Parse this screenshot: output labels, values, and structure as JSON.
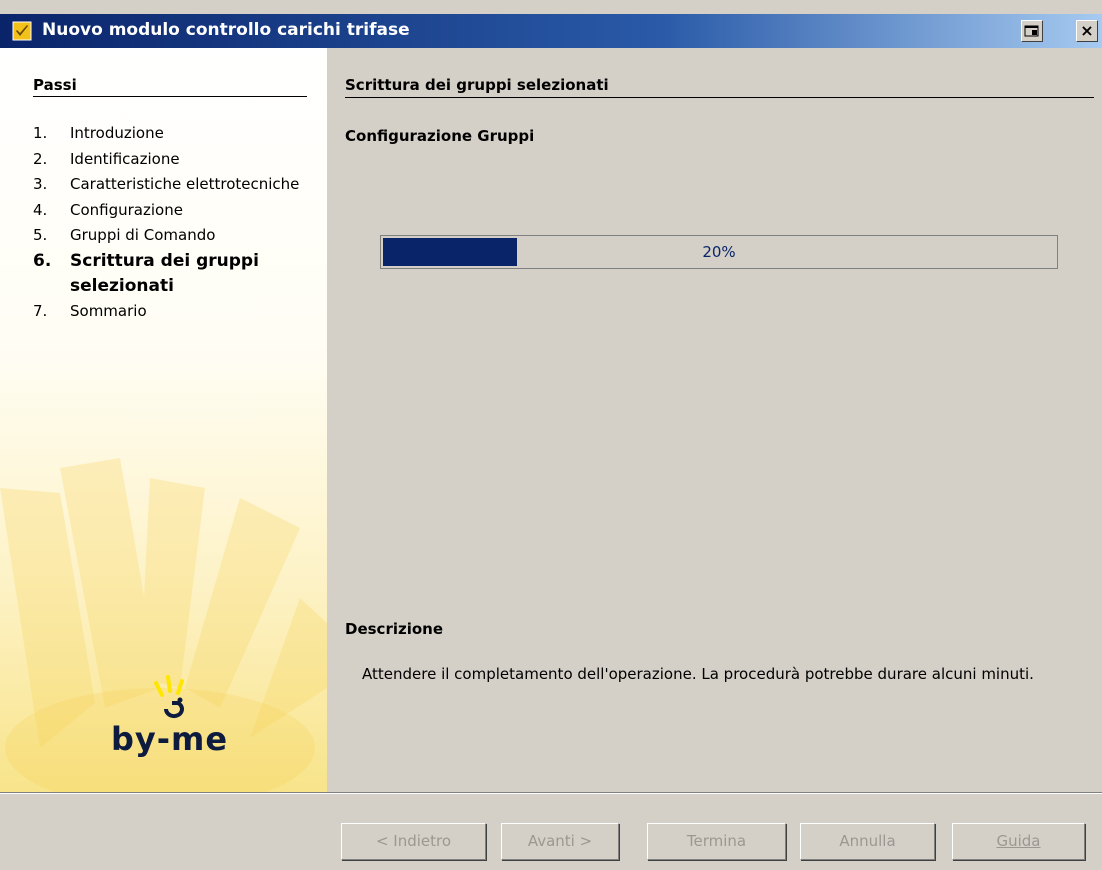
{
  "window": {
    "title": "Nuovo modulo controllo carichi trifase",
    "close_glyph": "×"
  },
  "sidebar": {
    "title": "Passi",
    "steps": [
      {
        "num": "1.",
        "label": "Introduzione"
      },
      {
        "num": "2.",
        "label": "Identificazione"
      },
      {
        "num": "3.",
        "label": "Caratteristiche elettrotecniche"
      },
      {
        "num": "4.",
        "label": "Configurazione"
      },
      {
        "num": "5.",
        "label": "Gruppi di Comando"
      },
      {
        "num": "6.",
        "label": "Scrittura dei gruppi selezionati"
      },
      {
        "num": "7.",
        "label": "Sommario"
      }
    ],
    "current_step": 6,
    "logo_text": "by-me"
  },
  "main": {
    "section_title": "Scrittura dei gruppi selezionati",
    "subsection_title": "Configurazione Gruppi",
    "progress": {
      "value": 20,
      "label": "20%"
    },
    "description": {
      "title": "Descrizione",
      "text": "Attendere il completamento dell'operazione. La procedurà potrebbe durare alcuni minuti."
    }
  },
  "buttons": {
    "back": "< Indietro",
    "next": "Avanti >",
    "finish": "Termina",
    "cancel": "Annulla",
    "help": "Guida"
  },
  "colors": {
    "title_bar": "#0a246a",
    "progress_fill": "#0a246a",
    "dialog_bg": "#d4d0c8",
    "sidebar_yellow": "#f8e48a"
  }
}
